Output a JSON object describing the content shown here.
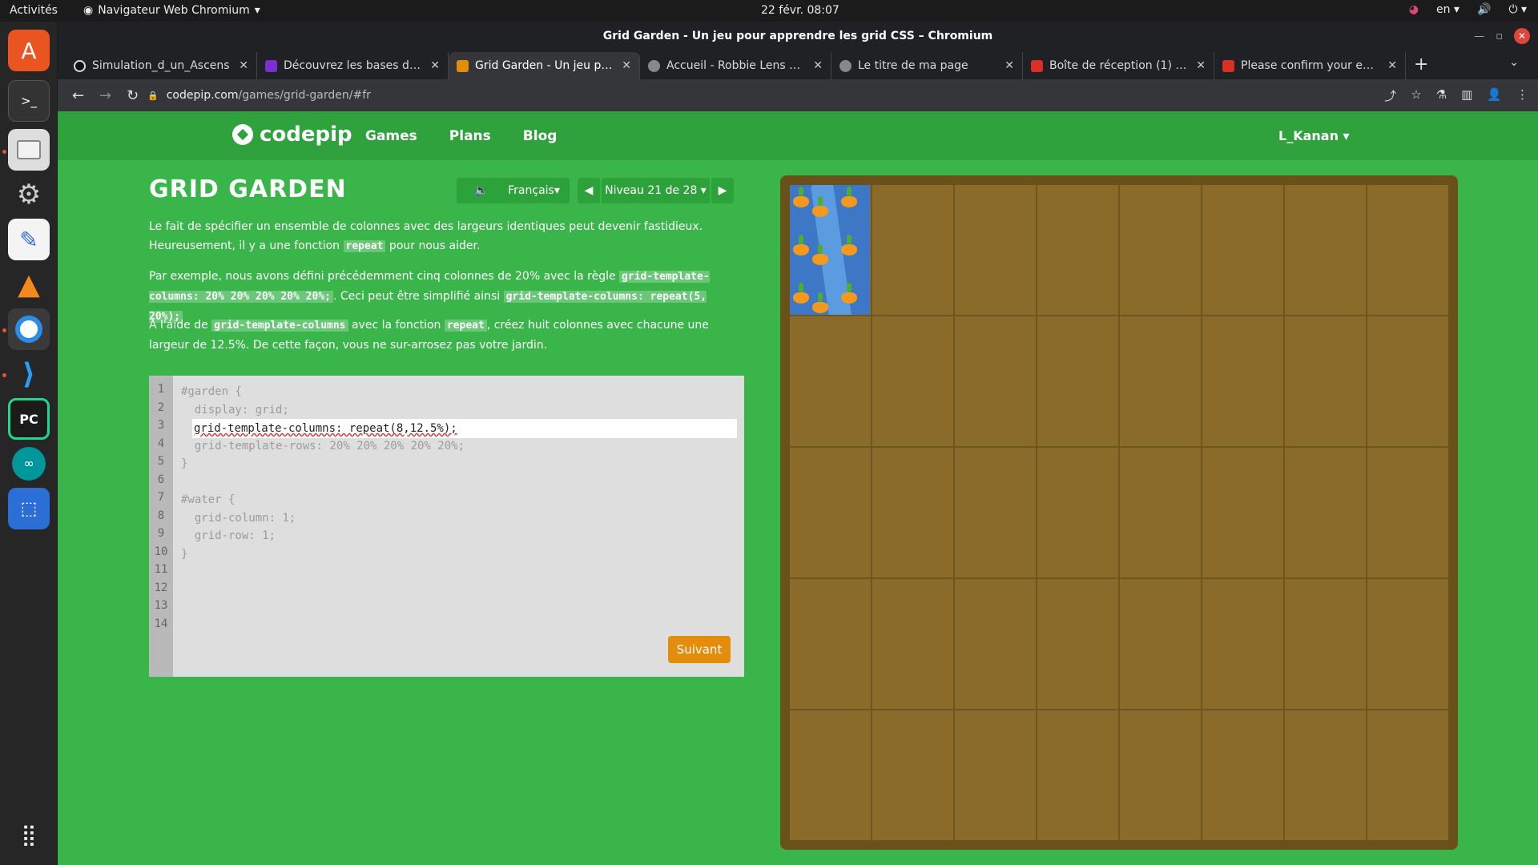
{
  "system": {
    "activities": "Activités",
    "app_name": "Navigateur Web Chromium",
    "clock": "22 févr.  08:07",
    "lang": "en"
  },
  "browser": {
    "window_title": "Grid Garden - Un jeu pour apprendre les grid CSS – Chromium",
    "tabs": [
      {
        "title": "Simulation_d_un_Ascens",
        "color": "#111111"
      },
      {
        "title": "Découvrez les bases de C",
        "color": "#7b2fd0"
      },
      {
        "title": "Grid Garden - Un jeu pour",
        "color": "#e28d0b"
      },
      {
        "title": "Accueil - Robbie Lens Pho",
        "color": "#888888"
      },
      {
        "title": "Le titre de ma page",
        "color": "#888888"
      },
      {
        "title": "Boîte de réception (1) - lu",
        "color": "#d93025"
      },
      {
        "title": "Please confirm your emai",
        "color": "#d93025"
      }
    ],
    "url_host": "codepip.com",
    "url_path": "/games/grid-garden/#fr"
  },
  "site": {
    "brand": "codepip",
    "menu": [
      "Games",
      "Plans",
      "Blog"
    ],
    "user": "L_Kanan"
  },
  "game": {
    "title": "GRID GARDEN",
    "language": "Français▾",
    "level": "Niveau 21 de 28 ▾",
    "p1a": "Le fait de spécifier un ensemble de colonnes avec des largeurs identiques peut devenir fastidieux. Heureusement, il y a une fonction ",
    "p1code": "repeat",
    "p1b": " pour nous aider.",
    "p2a": "Par exemple, nous avons défini précédemment cinq colonnes de 20% avec la règle ",
    "p2code1": "grid-template-columns: 20% 20% 20% 20% 20%;",
    "p2b": ". Ceci peut être simplifié ainsi ",
    "p2code2": "grid-template-columns: repeat(5, 20%);",
    "p3a": "A l'aide de ",
    "p3code1": "grid-template-columns",
    "p3b": " avec la fonction ",
    "p3code2": "repeat",
    "p3c": ", créez huit colonnes avec chacune une largeur de 12.5%. De cette façon, vous ne sur-arrosez pas votre jardin.",
    "line_numbers": [
      "1",
      "2",
      "3",
      "4",
      "5",
      "6",
      "7",
      "8",
      "9",
      "10",
      "11",
      "12",
      "13",
      "14"
    ],
    "code_lines": [
      "#garden {",
      "  display: grid;",
      "",
      "  grid-template-rows: 20% 20% 20% 20% 20%;",
      "}",
      "",
      "#water {",
      "  grid-column: 1;",
      "  grid-row: 1;",
      "}"
    ],
    "input_value": "grid-template-columns: repeat(8,12.5%);",
    "next_button": "Suivant"
  },
  "colors": {
    "page_bg": "#39b54a",
    "header_bg": "#2fa23d",
    "button_orange": "#e28d0b",
    "soil": "#8b6b2a",
    "water": "#3d77c5"
  }
}
